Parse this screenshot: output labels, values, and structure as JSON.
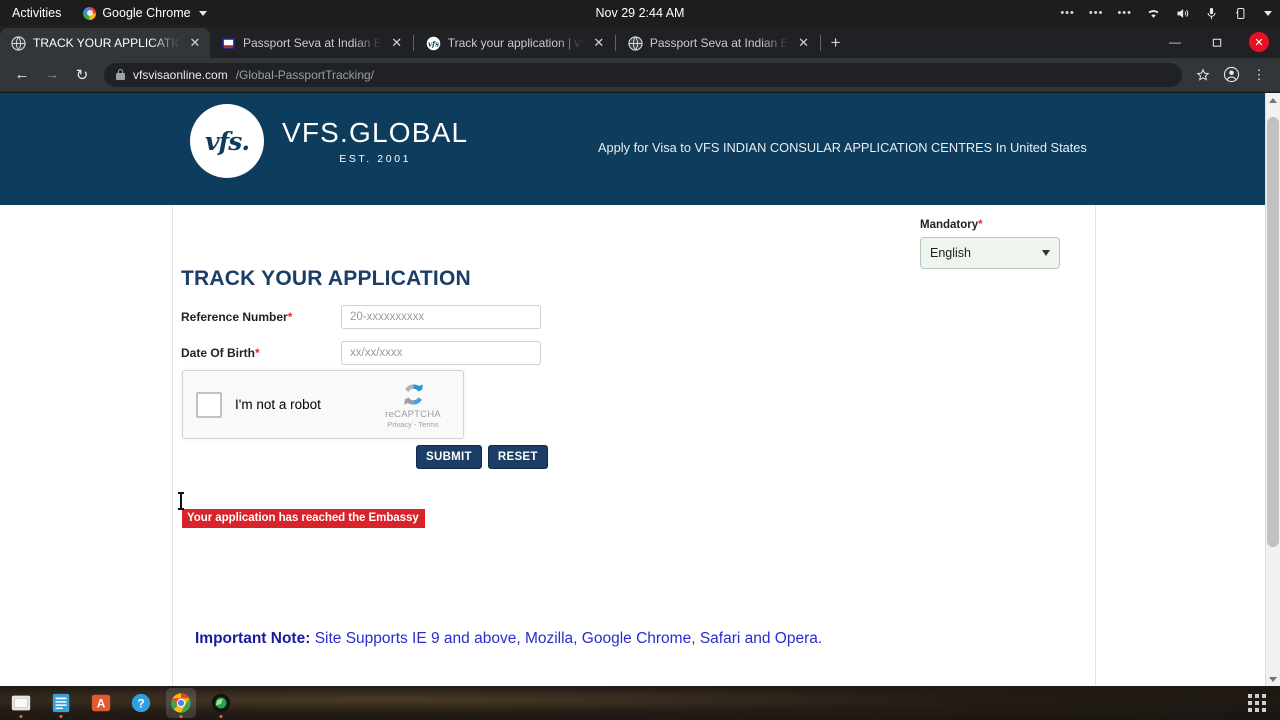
{
  "os_bar": {
    "activities": "Activities",
    "app_menu": "Google Chrome",
    "clock": "Nov 29  2:44 AM",
    "tray_icons": [
      "dots-menu-icon",
      "dots-menu-icon",
      "dots-menu-icon",
      "wifi-icon",
      "volume-icon",
      "microphone-icon",
      "battery-icon",
      "chevron-down-icon"
    ]
  },
  "browser": {
    "tabs": [
      {
        "title": "TRACK YOUR APPLICATIO",
        "favicon": "globe-icon",
        "active": true
      },
      {
        "title": "Passport Seva at Indian E",
        "favicon": "passport-seva-icon",
        "active": false
      },
      {
        "title": "Track your application | vf",
        "favicon": "vfs-icon",
        "active": false
      },
      {
        "title": "Passport Seva at Indian E",
        "favicon": "globe-icon",
        "active": false
      }
    ],
    "new_tab_label": "+",
    "window_controls": {
      "minimize": "—",
      "maximize": "❐",
      "close": "✕"
    },
    "nav": {
      "back": "←",
      "forward": "→",
      "reload": "↻"
    },
    "address": {
      "host": "vfsvisaonline.com",
      "path": "/Global-PassportTracking/",
      "secure": true
    },
    "toolbar_icons": [
      "bookmark-star-icon",
      "profile-icon",
      "chrome-menu-icon"
    ]
  },
  "site": {
    "header": {
      "logo_mark": "vfs.",
      "logo_name": "VFS.GLOBAL",
      "logo_est": "EST. 2001",
      "tagline": "Apply for Visa to VFS INDIAN CONSULAR APPLICATION CENTRES  In United States"
    },
    "language": {
      "label": "Mandatory",
      "required_mark": "*",
      "selected": "English",
      "options": [
        "English"
      ]
    },
    "form": {
      "title": "TRACK YOUR APPLICATION",
      "fields": [
        {
          "label": "Reference Number",
          "required_mark": "*",
          "value": "",
          "placeholder": "20-xxxxxxxxxx"
        },
        {
          "label": "Date Of Birth",
          "required_mark": "*",
          "value": "",
          "placeholder": "xx/xx/xxxx"
        }
      ],
      "captcha": {
        "checkbox_label": "I'm not a robot",
        "brand": "reCAPTCHA",
        "links": "Privacy - Terms",
        "checked": false
      },
      "buttons": {
        "submit": "SUBMIT",
        "reset": "RESET"
      }
    },
    "status_message": "Your application has reached the Embassy",
    "note": {
      "bold": "Important Note:",
      "text": " Site Supports IE 9 and above, Mozilla, Google Chrome, Safari and Opera."
    }
  },
  "colors": {
    "brand_navy": "#0d3c5c",
    "title_navy": "#1b3d66",
    "status_red": "#d8232a",
    "note_blue": "#2b2bd0",
    "required_star": "#e03030"
  },
  "dock": {
    "items": [
      {
        "name": "files-icon",
        "color": "#efeeeb",
        "running": true,
        "focused": false
      },
      {
        "name": "text-editor-icon",
        "color": "#3a9fd6",
        "running": true,
        "focused": false
      },
      {
        "name": "archive-manager-icon",
        "color": "#e05a33",
        "running": false,
        "focused": false
      },
      {
        "name": "help-icon",
        "color": "#2f9fe0",
        "running": false,
        "focused": false
      },
      {
        "name": "google-chrome-icon",
        "color": "#4285f4",
        "running": true,
        "focused": true
      },
      {
        "name": "web-browser-icon",
        "color": "#1d7a3c",
        "running": true,
        "focused": false
      }
    ],
    "app_grid": "show-applications-icon"
  }
}
